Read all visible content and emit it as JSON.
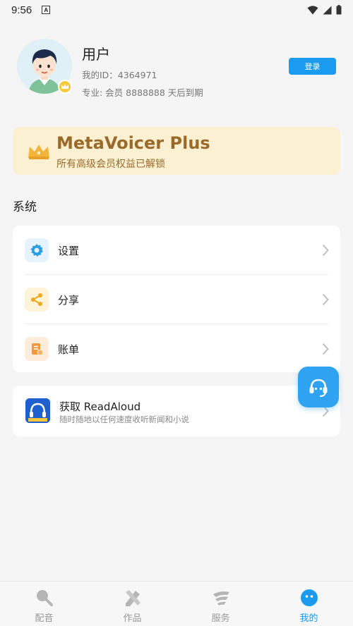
{
  "status_bar": {
    "time": "9:56",
    "notification_glyph": "A"
  },
  "profile": {
    "name": "用户",
    "id_text": "我的ID：4364971",
    "member_text": "专业: 会员 8888888 天后到期",
    "login_label": "登录"
  },
  "vip_banner": {
    "title": "MetaVoicer Plus",
    "subtitle": "所有高级会员权益已解锁"
  },
  "system": {
    "title": "系统",
    "items": [
      {
        "label": "设置",
        "icon": "gear-icon"
      },
      {
        "label": "分享",
        "icon": "share-icon"
      },
      {
        "label": "账单",
        "icon": "bill-icon"
      }
    ]
  },
  "promo": {
    "title": "获取 ReadAloud",
    "subtitle": "随时随地以任何速度收听新闻和小说",
    "icon_text": "ReadAloud"
  },
  "tabs": [
    {
      "label": "配音",
      "icon": "dubbing-icon",
      "active": false
    },
    {
      "label": "作品",
      "icon": "works-icon",
      "active": false
    },
    {
      "label": "服务",
      "icon": "service-icon",
      "active": false
    },
    {
      "label": "我的",
      "icon": "mine-icon",
      "active": true
    }
  ],
  "colors": {
    "accent": "#1a9bf0",
    "vip_background": "#fcf0d3",
    "vip_text": "#9a6a2a",
    "page_background": "#f5f5f6"
  }
}
